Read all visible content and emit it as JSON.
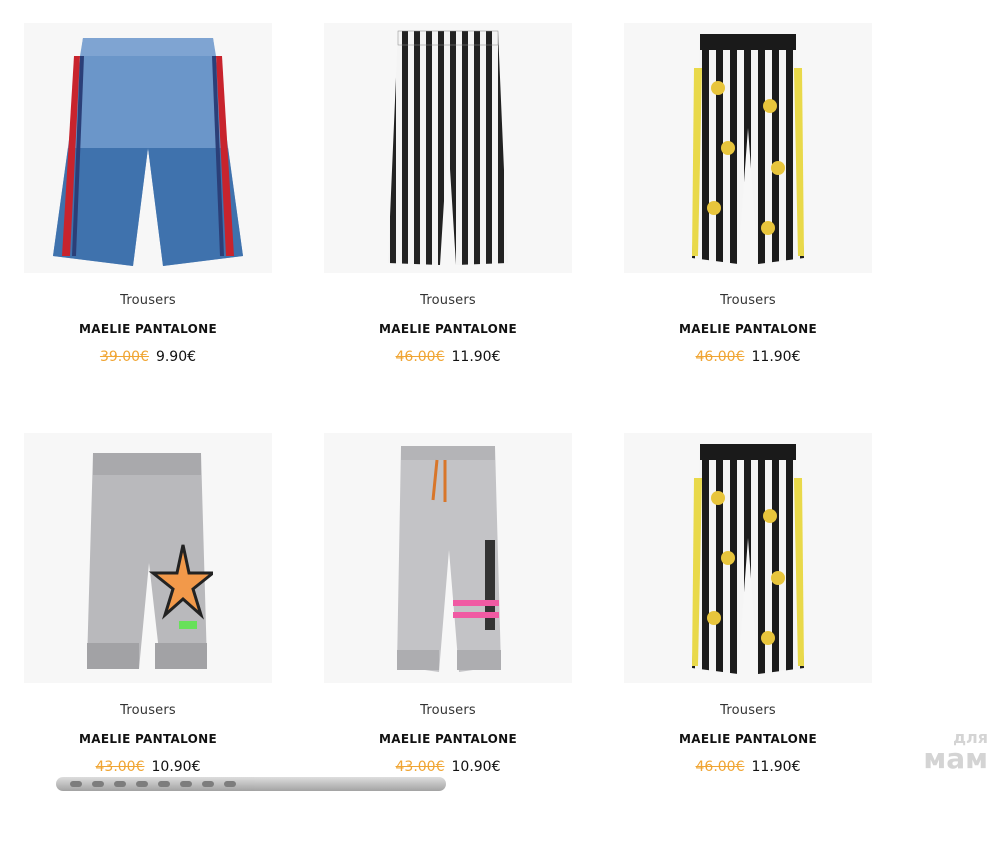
{
  "products": [
    {
      "category": "Trousers",
      "name": "MAELIE PANTALONE",
      "old_price": "39.00€",
      "new_price": "9.90€",
      "image": "blue-shorts-with-red-stripes"
    },
    {
      "category": "Trousers",
      "name": "MAELIE PANTALONE",
      "old_price": "46.00€",
      "new_price": "11.90€",
      "image": "black-white-striped-trousers"
    },
    {
      "category": "Trousers",
      "name": "MAELIE PANTALONE",
      "old_price": "46.00€",
      "new_price": "11.90€",
      "image": "striped-floral-joggers"
    },
    {
      "category": "Trousers",
      "name": "MAELIE PANTALONE",
      "old_price": "43.00€",
      "new_price": "10.90€",
      "image": "grey-joggers-with-star"
    },
    {
      "category": "Trousers",
      "name": "MAELIE PANTALONE",
      "old_price": "43.00€",
      "new_price": "10.90€",
      "image": "grey-joggers-startmoving"
    },
    {
      "category": "Trousers",
      "name": "MAELIE PANTALONE",
      "old_price": "46.00€",
      "new_price": "11.90€",
      "image": "striped-floral-joggers"
    }
  ],
  "watermark": {
    "line1": "для",
    "line2": "мам"
  }
}
